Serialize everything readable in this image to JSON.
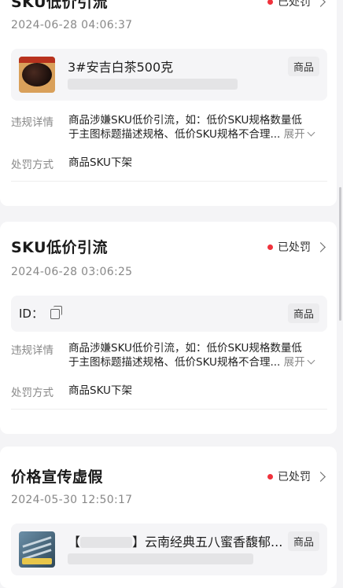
{
  "cards": [
    {
      "title": "SKU低价引流",
      "status": "已处罚",
      "date": "2024-06-28 04:06:37",
      "product": {
        "name": "3#安吉白茶500克",
        "badge": "商品"
      },
      "details_label": "违规详情",
      "details_line1": "商品涉嫌SKU低价引流，如：低价SKU规格数量低",
      "details_line2": "于主图标题描述规格、低价SKU规格不合理...",
      "expand_label": "展开",
      "punish_label": "处罚方式",
      "punish_value": "商品SKU下架"
    },
    {
      "title": "SKU低价引流",
      "status": "已处罚",
      "date": "2024-06-28 03:06:25",
      "product": {
        "id_label": "ID：",
        "badge": "商品"
      },
      "details_label": "违规详情",
      "details_line1": "商品涉嫌SKU低价引流，如：低价SKU规格数量低",
      "details_line2": "于主图标题描述规格、低价SKU规格不合理...",
      "expand_label": "展开",
      "punish_label": "处罚方式",
      "punish_value": "商品SKU下架"
    },
    {
      "title": "价格宣传虚假",
      "status": "已处罚",
      "date": "2024-05-30 12:50:17",
      "product": {
        "name_prefix": "【",
        "name_suffix": "】云南经典五八蜜香馥郁...",
        "badge": "商品"
      }
    }
  ],
  "colors": {
    "status_dot": "#f0323c",
    "page_bg": "#f4f4f6"
  },
  "icons": [
    "chevron-right-icon",
    "copy-icon",
    "chevron-down-icon"
  ]
}
